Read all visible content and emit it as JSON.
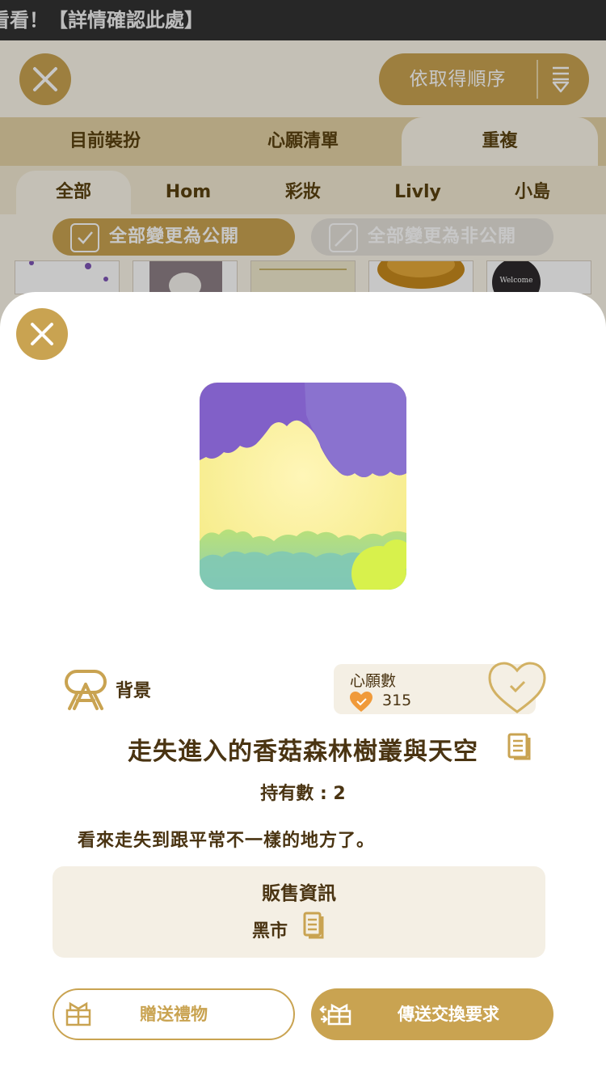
{
  "ticker": {
    "text": "看看！【詳情確認此處】"
  },
  "header": {
    "sort_label": "依取得順序"
  },
  "tabs": [
    {
      "label": "目前裝扮"
    },
    {
      "label": "心願清單"
    },
    {
      "label": "重複",
      "active": true
    }
  ],
  "subtabs": [
    {
      "label": "全部",
      "active": true
    },
    {
      "label": "Hom"
    },
    {
      "label": "彩妝"
    },
    {
      "label": "Livly"
    },
    {
      "label": "小島"
    }
  ],
  "bulk": {
    "public_label": "全部變更為公開",
    "private_label": "全部變更為非公開"
  },
  "thumbnails": [
    {
      "name": "thumb-1"
    },
    {
      "name": "thumb-2"
    },
    {
      "name": "thumb-3"
    },
    {
      "name": "thumb-4"
    },
    {
      "name": "thumb-5",
      "text": "Welcome"
    }
  ],
  "item": {
    "category": "背景",
    "wish_label": "心願數",
    "wish_count": "315",
    "title": "走失進入的香菇森林樹叢與天空",
    "owned": "持有數 : 2",
    "description": "看來走失到跟平常不一樣的地方了。"
  },
  "sale": {
    "title": "販售資訊",
    "value": "黑市"
  },
  "actions": {
    "gift_label": "贈送禮物",
    "trade_label": "傳送交換要求"
  },
  "colors": {
    "accent": "#c9a351",
    "text": "#4a3412",
    "panel": "#f4efe4",
    "heart": "#f09a3a"
  }
}
